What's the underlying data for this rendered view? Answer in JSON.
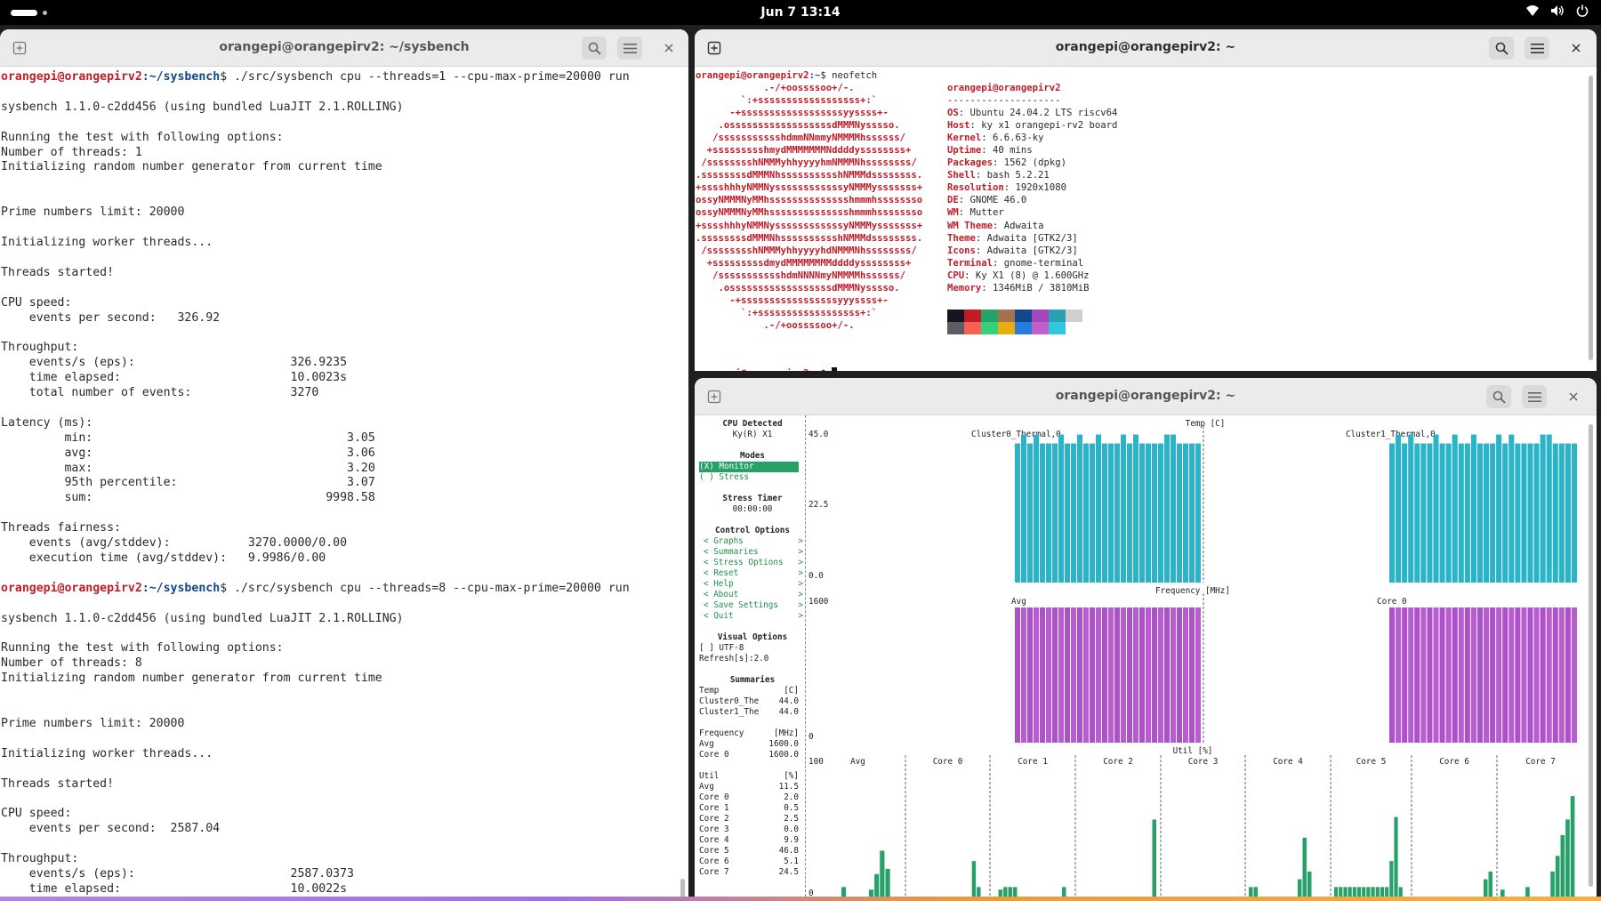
{
  "topbar": {
    "clock": "Jun 7  13:14"
  },
  "left_window": {
    "title": "orangepi@orangepirv2: ~/sysbench",
    "prompt_user": "orangepi@orangepirv2",
    "prompt_path": ":~/sysbench",
    "lines": [
      {
        "p": true,
        "cmd": "$ ./src/sysbench cpu --threads=1 --cpu-max-prime=20000 run"
      },
      {
        "t": ""
      },
      {
        "t": "sysbench 1.1.0-c2dd456 (using bundled LuaJIT 2.1.ROLLING)"
      },
      {
        "t": ""
      },
      {
        "t": "Running the test with following options:"
      },
      {
        "t": "Number of threads: 1"
      },
      {
        "t": "Initializing random number generator from current time"
      },
      {
        "t": ""
      },
      {
        "t": ""
      },
      {
        "t": "Prime numbers limit: 20000"
      },
      {
        "t": ""
      },
      {
        "t": "Initializing worker threads..."
      },
      {
        "t": ""
      },
      {
        "t": "Threads started!"
      },
      {
        "t": ""
      },
      {
        "t": "CPU speed:"
      },
      {
        "t": "    events per second:   326.92"
      },
      {
        "t": ""
      },
      {
        "t": "Throughput:"
      },
      {
        "t": "    events/s (eps):                      326.9235"
      },
      {
        "t": "    time elapsed:                        10.0023s"
      },
      {
        "t": "    total number of events:              3270"
      },
      {
        "t": ""
      },
      {
        "t": "Latency (ms):"
      },
      {
        "t": "         min:                                    3.05"
      },
      {
        "t": "         avg:                                    3.06"
      },
      {
        "t": "         max:                                    3.20"
      },
      {
        "t": "         95th percentile:                        3.07"
      },
      {
        "t": "         sum:                                 9998.58"
      },
      {
        "t": ""
      },
      {
        "t": "Threads fairness:"
      },
      {
        "t": "    events (avg/stddev):           3270.0000/0.00"
      },
      {
        "t": "    execution time (avg/stddev):   9.9986/0.00"
      },
      {
        "t": ""
      },
      {
        "p": true,
        "cmd": "$ ./src/sysbench cpu --threads=8 --cpu-max-prime=20000 run"
      },
      {
        "t": ""
      },
      {
        "t": "sysbench 1.1.0-c2dd456 (using bundled LuaJIT 2.1.ROLLING)"
      },
      {
        "t": ""
      },
      {
        "t": "Running the test with following options:"
      },
      {
        "t": "Number of threads: 8"
      },
      {
        "t": "Initializing random number generator from current time"
      },
      {
        "t": ""
      },
      {
        "t": ""
      },
      {
        "t": "Prime numbers limit: 20000"
      },
      {
        "t": ""
      },
      {
        "t": "Initializing worker threads..."
      },
      {
        "t": ""
      },
      {
        "t": "Threads started!"
      },
      {
        "t": ""
      },
      {
        "t": "CPU speed:"
      },
      {
        "t": "    events per second:  2587.04"
      },
      {
        "t": ""
      },
      {
        "t": "Throughput:"
      },
      {
        "t": "    events/s (eps):                      2587.0373"
      },
      {
        "t": "    time elapsed:                        10.0022s"
      }
    ]
  },
  "neofetch_window": {
    "title": "orangepi@orangepirv2: ~",
    "prompt_user": "orangepi@orangepirv2",
    "prompt_path": ":~",
    "command": "$ neofetch",
    "logo": [
      "            .-/+oossssoo+/-.",
      "        `:+ssssssssssssssssss+:`",
      "      -+ssssssssssssssssssyyssss+-",
      "    .ossssssssssssssssssdMMMNysssso.",
      "   /ssssssssssshdmmNNmmyNMMMMhssssss/",
      "  +ssssssssshmydMMMMMMMNddddyssssssss+",
      " /sssssssshNMMMyhhyyyyhmNMMMNhssssssss/",
      ".ssssssssdMMMNhsssssssssshNMMMdssssssss.",
      "+sssshhhyNMMNyssssssssssssyNMMMysssssss+",
      "ossyNMMMNyMMhsssssssssssssshmmmhssssssso",
      "ossyNMMMNyMMhsssssssssssssshmmmhssssssso",
      "+sssshhhyNMMNyssssssssssssyNMMMysssssss+",
      ".ssssssssdMMMNhsssssssssshNMMMdssssssss.",
      " /sssssssshNMMMyhhyyyyhdNMMMNhssssssss/",
      "  +sssssssssdmydMMMMMMMMddddyssssssss+",
      "   /ssssssssssshdmNNNNmyNMMMMhssssss/",
      "    .ossssssssssssssssssdMMMNysssso.",
      "      -+sssssssssssssssssyyyssss+-",
      "        `:+ssssssssssssssssss+:`",
      "            .-/+oossssoo+/-."
    ],
    "user_host": "orangepi@orangepirv2",
    "separator": "--------------------",
    "info": [
      {
        "k": "OS",
        "v": "Ubuntu 24.04.2 LTS riscv64"
      },
      {
        "k": "Host",
        "v": "ky x1 orangepi-rv2 board"
      },
      {
        "k": "Kernel",
        "v": "6.6.63-ky"
      },
      {
        "k": "Uptime",
        "v": "40 mins"
      },
      {
        "k": "Packages",
        "v": "1562 (dpkg)"
      },
      {
        "k": "Shell",
        "v": "bash 5.2.21"
      },
      {
        "k": "Resolution",
        "v": "1920x1080"
      },
      {
        "k": "DE",
        "v": "GNOME 46.0"
      },
      {
        "k": "WM",
        "v": "Mutter"
      },
      {
        "k": "WM Theme",
        "v": "Adwaita"
      },
      {
        "k": "Theme",
        "v": "Adwaita [GTK2/3]"
      },
      {
        "k": "Icons",
        "v": "Adwaita [GTK2/3]"
      },
      {
        "k": "Terminal",
        "v": "gnome-terminal"
      },
      {
        "k": "CPU",
        "v": "Ky X1 (8) @ 1.600GHz"
      },
      {
        "k": "Memory",
        "v": "1346MiB / 3810MiB"
      }
    ],
    "palette_top": [
      "#171421",
      "#c01c28",
      "#26a269",
      "#a2734c",
      "#12488b",
      "#a347ba",
      "#2aa1b3",
      "#d0cfcc"
    ],
    "palette_bottom": [
      "#5e5c64",
      "#f66151",
      "#33d17a",
      "#e9ad0c",
      "#2a7bde",
      "#c061cb",
      "#33c7de",
      "#ffffff"
    ],
    "final_prompt": "$ "
  },
  "stui_window": {
    "title": "orangepi@orangepirv2: ~",
    "sidebar": {
      "cpu_detected_h": "CPU Detected",
      "cpu_detected_v": "Ky(R) X1",
      "modes_h": "Modes",
      "mode_monitor": "(X) Monitor",
      "mode_stress": "( ) Stress",
      "stress_timer_h": "Stress Timer",
      "stress_timer_v": "00:00:00",
      "control_h": "Control Options",
      "controls": [
        "< Graphs           >",
        "< Summaries        >",
        "< Stress Options   >",
        "< Reset            >",
        "< Help             >",
        "< About            >",
        "< Save Settings    >",
        "< Quit             >"
      ],
      "visual_h": "Visual Options",
      "utf8": "[ ] UTF-8",
      "refresh": "Refresh[s]:2.0",
      "summaries_h": "Summaries",
      "summary_rows": [
        {
          "k": "Temp",
          "v": "[C]"
        },
        {
          "k": "Cluster0_The",
          "v": "44.0"
        },
        {
          "k": "Cluster1_The",
          "v": "44.0"
        },
        {
          "k": "",
          "v": ""
        },
        {
          "k": "Frequency",
          "v": "[MHz]"
        },
        {
          "k": "Avg",
          "v": "1600.0"
        },
        {
          "k": "Core 0",
          "v": "1600.0"
        },
        {
          "k": "",
          "v": ""
        },
        {
          "k": "Util",
          "v": "[%]"
        },
        {
          "k": "Avg",
          "v": "11.5"
        },
        {
          "k": "Core 0",
          "v": "2.0"
        },
        {
          "k": "Core 1",
          "v": "0.5"
        },
        {
          "k": "Core 2",
          "v": "2.5"
        },
        {
          "k": "Core 3",
          "v": "0.0"
        },
        {
          "k": "Core 4",
          "v": "9.9"
        },
        {
          "k": "Core 5",
          "v": "46.8"
        },
        {
          "k": "Core 6",
          "v": "5.1"
        },
        {
          "k": "Core 7",
          "v": "24.5"
        }
      ]
    },
    "temp": {
      "title": "Temp [C]",
      "y_top": "45.0",
      "y_mid": "22.5",
      "y_bot": "0.0",
      "series": [
        {
          "name": "Cluster0_Thermal,0",
          "value": 44.0
        },
        {
          "name": "Cluster1_Thermal,0",
          "value": 44.0
        }
      ]
    },
    "freq": {
      "title": "Frequency [MHz]",
      "y_top": "1600",
      "y_bot": "0",
      "series": [
        {
          "name": "Avg",
          "value": 1600.0
        },
        {
          "name": "Core 0",
          "value": 1600.0
        }
      ]
    },
    "util": {
      "title": "Util [%]",
      "y_top": "100",
      "y_bot": "0",
      "series": [
        "Avg",
        "Core 0",
        "Core 1",
        "Core 2",
        "Core 3",
        "Core 4",
        "Core 5",
        "Core 6",
        "Core 7"
      ]
    }
  },
  "colors": {
    "temp_bar": "#2bb3c8",
    "freq_bar": "#b04fcb",
    "util_bar": "#26a269",
    "prompt_red": "#c01c28",
    "path_blue": "#12488b"
  }
}
